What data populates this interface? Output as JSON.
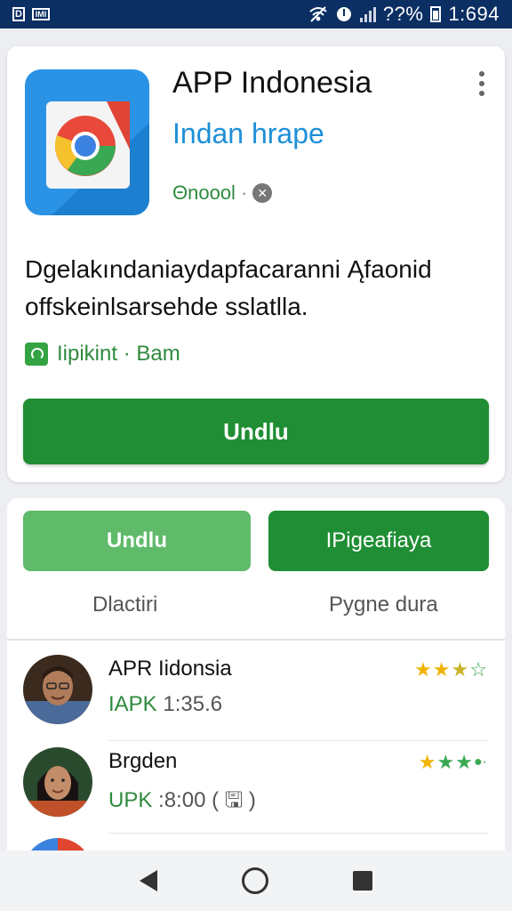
{
  "status_bar": {
    "left_icon_1": "D",
    "left_icon_2": "IMI",
    "battery_text": "??%",
    "time": "1:694",
    "icons": [
      "wifi-icon",
      "alarm-icon",
      "signal-icon",
      "battery-icon"
    ]
  },
  "app": {
    "title": "APP Indonesia",
    "subtitle": "Indan hrape",
    "meta_text": "Θnoool",
    "meta_dot": "·",
    "description": "Dgelakındaniaydapfacaranni Ąfaonid offskeinlsarsehde sslatlla.",
    "tagline": "Iipikint · Bam",
    "install_button": "Undlu"
  },
  "actions": {
    "left_button": "Undlu",
    "right_button": "IPigeafiaya"
  },
  "tabs": {
    "left": "Dlactiri",
    "right": "Pygne dura"
  },
  "reviews": [
    {
      "name": "APR Iidonsia",
      "meta_key": "IAPK",
      "meta_value": "1:35.6",
      "stars_text": "★★★☆"
    },
    {
      "name": "Brgden",
      "meta_key": "UPK",
      "meta_value": ":8:00 ( 🖫 )",
      "stars_text": "★★★·"
    }
  ],
  "colors": {
    "status_bar": "#0b2e63",
    "primary_green": "#1f8e34",
    "light_green": "#5fba6a",
    "link_blue": "#1e8fd8",
    "star_yellow": "#f0b400"
  }
}
